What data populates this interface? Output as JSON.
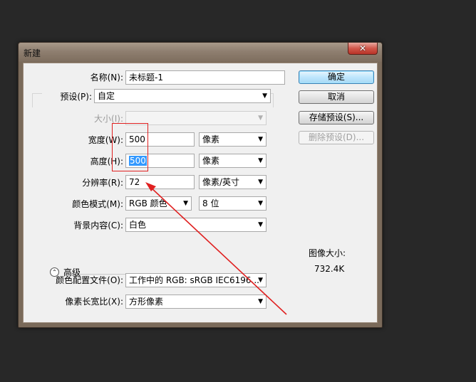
{
  "window": {
    "title": "新建"
  },
  "form": {
    "name": {
      "label": "名称(N):",
      "value": "未标题-1"
    },
    "preset": {
      "label": "预设(P):",
      "value": "自定"
    },
    "size": {
      "label": "大小(I):",
      "value": ""
    },
    "width": {
      "label": "宽度(W):",
      "value": "500",
      "unit": "像素"
    },
    "height": {
      "label": "高度(H):",
      "value": "500",
      "unit": "像素"
    },
    "resolution": {
      "label": "分辨率(R):",
      "value": "72",
      "unit": "像素/英寸"
    },
    "color_mode": {
      "label": "颜色模式(M):",
      "value": "RGB 颜色",
      "depth": "8 位"
    },
    "background": {
      "label": "背景内容(C):",
      "value": "白色"
    },
    "advanced": {
      "label": "高级"
    },
    "color_profile": {
      "label": "颜色配置文件(O):",
      "value": "工作中的 RGB: sRGB IEC6196..."
    },
    "pixel_aspect": {
      "label": "像素长宽比(X):",
      "value": "方形像素"
    }
  },
  "buttons": {
    "ok": "确定",
    "cancel": "取消",
    "save_preset": "存储预设(S)...",
    "delete_preset": "删除预设(D)..."
  },
  "image_size": {
    "label": "图像大小:",
    "value": "732.4K"
  },
  "colors": {
    "annotation": "#e02020",
    "window_frame": "#7a6a5a",
    "background": "#282828"
  }
}
